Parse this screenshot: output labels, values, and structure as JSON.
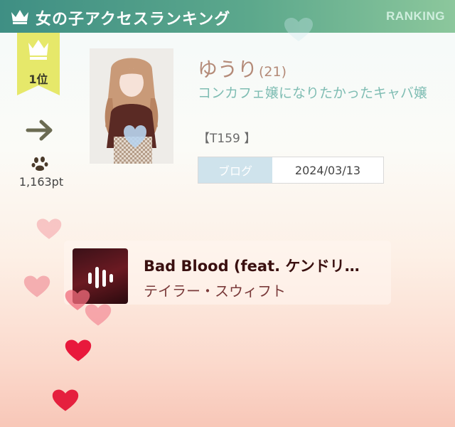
{
  "header": {
    "title": "女の子アクセスランキング",
    "right_label": "RANKING",
    "icon": "crown-icon"
  },
  "rank": {
    "label": "1位",
    "trend_icon": "arrow-right-icon",
    "points_icon": "paw-icon",
    "points": "1,163pt"
  },
  "profile": {
    "name": "ゆうり",
    "age": "(21)",
    "catchphrase": "コンカフェ嬢になりたかったキャバ嬢",
    "tag": "【T159 】",
    "blog_label": "ブログ",
    "blog_date": "2024/03/13"
  },
  "music": {
    "title": "Bad Blood (feat. ケンドリ…",
    "artist": "テイラー・スウィフト",
    "play_icon": "audio-bars-icon"
  },
  "colors": {
    "header_start": "#3f8f84",
    "header_end": "#8cc79c",
    "ribbon": "#e8ea6a",
    "name": "#b48a78",
    "catchphrase": "#7fbdb3",
    "heart": "#e8193c"
  }
}
